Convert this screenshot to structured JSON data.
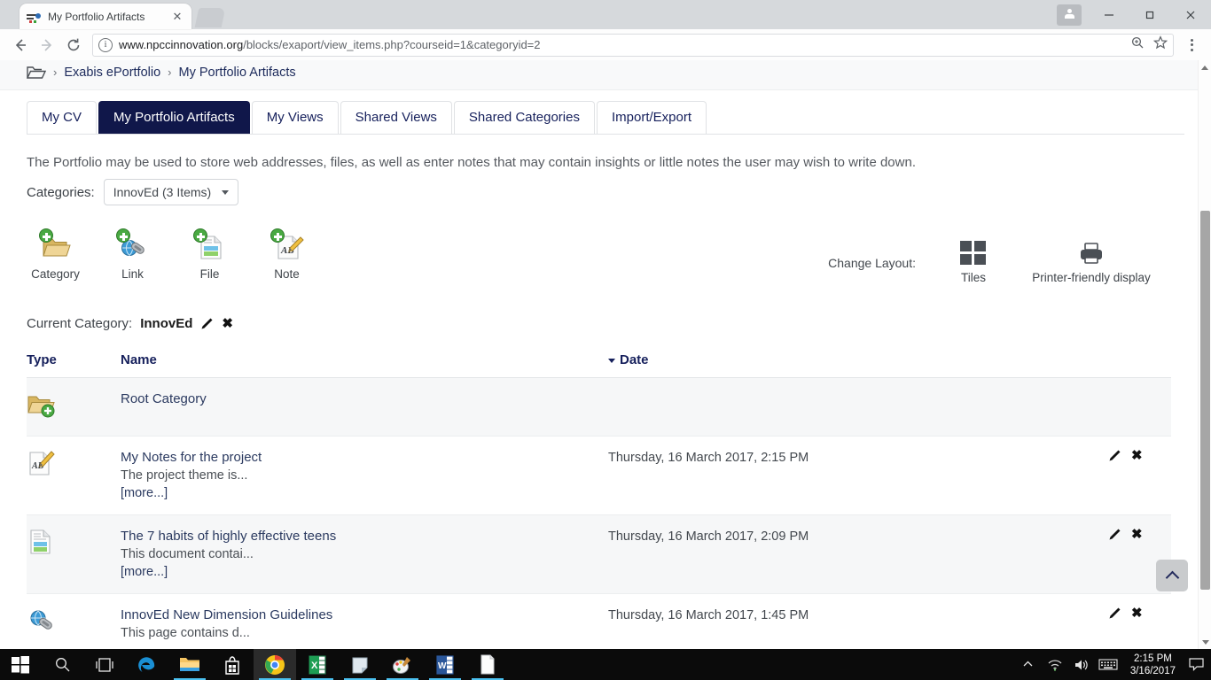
{
  "browser": {
    "tab_title": "My Portfolio Artifacts",
    "tab_favicon": "portfolio-favicon",
    "close_tab_glyph": "✕",
    "url_display": "www.npccinnovation.org",
    "url_path": "/blocks/exaport/view_items.php?courseid=1&categoryid=2",
    "back_glyph": "←",
    "forward_glyph": "→",
    "reload_glyph": "⟳",
    "minimize_glyph": "—",
    "maximize_glyph": "❐",
    "close_glyph": "✕"
  },
  "breadcrumb": {
    "folder_icon": "folder-icon",
    "separator": "›",
    "items": [
      {
        "label": "Exabis ePortfolio"
      },
      {
        "label": "My Portfolio Artifacts"
      }
    ]
  },
  "tabs": [
    {
      "label": "My CV",
      "active": false
    },
    {
      "label": "My Portfolio Artifacts",
      "active": true
    },
    {
      "label": "My Views",
      "active": false
    },
    {
      "label": "Shared Views",
      "active": false
    },
    {
      "label": "Shared Categories",
      "active": false
    },
    {
      "label": "Import/Export",
      "active": false
    }
  ],
  "intro_text": "The Portfolio may be used to store web addresses, files, as well as enter notes that may contain insights or little notes the user may wish to write down.",
  "categories": {
    "label": "Categories:",
    "selected": "InnovEd (3 Items)"
  },
  "toolbar": {
    "items": [
      {
        "label": "Category",
        "icon": "add-category-icon"
      },
      {
        "label": "Link",
        "icon": "add-link-icon"
      },
      {
        "label": "File",
        "icon": "add-file-icon"
      },
      {
        "label": "Note",
        "icon": "add-note-icon"
      }
    ]
  },
  "layout": {
    "label": "Change Layout:",
    "tiles_label": "Tiles",
    "printer_label": "Printer-friendly display"
  },
  "current_category": {
    "label": "Current Category:",
    "name": "InnovEd",
    "edit_icon": "pencil-icon",
    "delete_icon": "close-icon"
  },
  "table": {
    "columns": {
      "type": "Type",
      "name": "Name",
      "date": "Date"
    },
    "sort_column": "Date",
    "sort_direction": "desc",
    "rows": [
      {
        "icon": "root-category-icon",
        "title": "Root Category",
        "desc": "",
        "more": "",
        "date": "",
        "actions": false
      },
      {
        "icon": "note-icon",
        "title": "My Notes for the project",
        "desc": "The project theme is...",
        "more": "[more...]",
        "date": "Thursday, 16 March 2017, 2:15 PM",
        "actions": true
      },
      {
        "icon": "file-icon",
        "title": "The 7 habits of highly effective teens",
        "desc": "This document contai...",
        "more": "[more...]",
        "date": "Thursday, 16 March 2017, 2:09 PM",
        "actions": true
      },
      {
        "icon": "link-icon",
        "title": "InnovEd New Dimension Guidelines",
        "desc": "This page contains d...",
        "more": "",
        "date": "Thursday, 16 March 2017, 1:45 PM",
        "actions": true
      }
    ],
    "row_edit_icon": "pencil-icon",
    "row_delete_icon": "close-icon"
  },
  "scroll_top_button": "scroll-to-top-icon",
  "taskbar": {
    "items": [
      {
        "name": "start-button",
        "label": "Start"
      },
      {
        "name": "search-button",
        "label": "Search"
      },
      {
        "name": "task-view-button",
        "label": "Task View"
      },
      {
        "name": "edge-button",
        "label": "Microsoft Edge"
      },
      {
        "name": "file-explorer-button",
        "label": "File Explorer"
      },
      {
        "name": "store-button",
        "label": "Microsoft Store"
      },
      {
        "name": "chrome-button",
        "label": "Google Chrome"
      },
      {
        "name": "excel-button",
        "label": "Excel"
      },
      {
        "name": "sticky-notes-button",
        "label": "Sticky Notes"
      },
      {
        "name": "paint-button",
        "label": "Paint"
      },
      {
        "name": "word-button",
        "label": "Word"
      },
      {
        "name": "document-button",
        "label": "Document"
      }
    ],
    "tray": {
      "chevron": "show-hidden-icons",
      "network": "wifi-icon",
      "volume": "volume-icon",
      "keyboard": "keyboard-icon",
      "time": "2:15 PM",
      "date": "3/16/2017",
      "action_center": "action-center-icon"
    }
  },
  "colors": {
    "active_tab_bg": "#10174a",
    "link_text": "#2b3a60",
    "stripe": "#f6f7f8",
    "taskbar": "#0b0b0b",
    "accent_blue": "#4cc2f1"
  }
}
